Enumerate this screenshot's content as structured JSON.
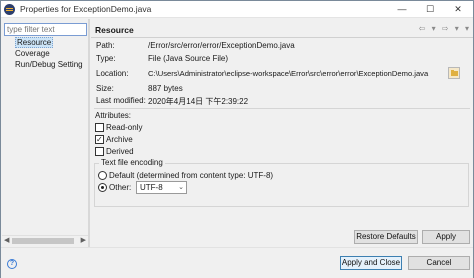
{
  "window": {
    "title": "Properties for ExceptionDemo.java",
    "minimize": "—",
    "maximize": "☐",
    "close": "✕"
  },
  "sidebar": {
    "filter_placeholder": "type filter text",
    "items": [
      {
        "label": "Resource",
        "selected": true
      },
      {
        "label": "Coverage",
        "selected": false
      },
      {
        "label": "Run/Debug Setting",
        "selected": false
      }
    ]
  },
  "page": {
    "title": "Resource",
    "nav": "⇦ ▾ ⇨ ▾ ▾"
  },
  "info": {
    "path_label": "Path:",
    "path_value": "/Error/src/error/error/ExceptionDemo.java",
    "type_label": "Type:",
    "type_value": "File  (Java Source File)",
    "location_label": "Location:",
    "location_value": "C:\\Users\\Administrator\\eclipse-workspace\\Error\\src\\error\\error\\ExceptionDemo.java",
    "size_label": "Size:",
    "size_value": "887  bytes",
    "modified_label": "Last modified:",
    "modified_value": "2020年4月14日 下午2:39:22"
  },
  "attributes": {
    "heading": "Attributes:",
    "items": [
      {
        "label": "Read-only",
        "checked": false
      },
      {
        "label": "Archive",
        "checked": true
      },
      {
        "label": "Derived",
        "checked": false
      }
    ]
  },
  "encoding": {
    "group_title": "Text file encoding",
    "default_label": "Default (determined from content type: UTF-8)",
    "other_label": "Other:",
    "other_value": "UTF-8",
    "selected": "other"
  },
  "buttons": {
    "restore_defaults": "Restore Defaults",
    "apply": "Apply",
    "apply_and_close": "Apply and Close",
    "cancel": "Cancel"
  },
  "help": {
    "glyph": "?"
  }
}
